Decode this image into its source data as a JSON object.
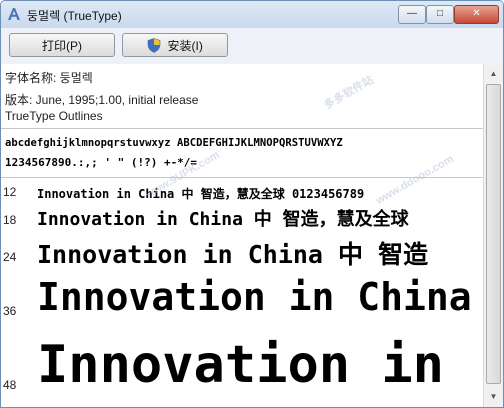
{
  "window": {
    "title": "둥멀렉 (TrueType)",
    "minimize_symbol": "—",
    "maximize_symbol": "□",
    "close_symbol": "✕"
  },
  "toolbar": {
    "print_label": "打印(P)",
    "install_label": "安装(I)"
  },
  "info": {
    "font_name": "字体名称: 둥멀렉",
    "version": "版本: June, 1995;1.00, initial release",
    "outline_type": "TrueType Outlines"
  },
  "charset": {
    "line1": "abcdefghijklmnopqrstuvwxyz ABCDEFGHIJKLMNOPQRSTUVWXYZ",
    "line2": "1234567890.:,; ' \" (!?) +-*/="
  },
  "samples": [
    {
      "size": "12",
      "text": "Innovation in China 中  智造，慧及全球 0123456789"
    },
    {
      "size": "18",
      "text": "Innovation in China 中  智造，慧及全球"
    },
    {
      "size": "24",
      "text": "Innovation in China 中  智造"
    },
    {
      "size": "36",
      "text": "Innovation in China"
    },
    {
      "size": "48",
      "text": "Innovation in"
    }
  ],
  "watermarks": {
    "site1": "多多软件站",
    "site2": "www.9UPK.com",
    "site3": "www.ddooo.com"
  },
  "colors": {
    "titlebar": "#c9d9ee",
    "close_button": "#c54b35",
    "content_bg": "#ffffff"
  }
}
